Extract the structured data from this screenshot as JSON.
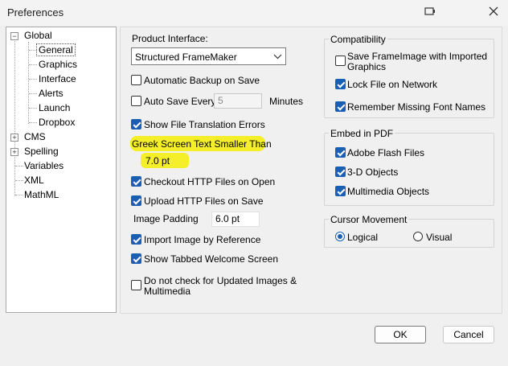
{
  "window": {
    "title": "Preferences"
  },
  "tree": {
    "items": [
      "Global",
      "General",
      "Graphics",
      "Interface",
      "Alerts",
      "Launch",
      "Dropbox",
      "CMS",
      "Spelling",
      "Variables",
      "XML",
      "MathML"
    ]
  },
  "general": {
    "product_interface_label": "Product Interface:",
    "product_interface_value": "Structured FrameMaker",
    "auto_backup_label": "Automatic Backup on Save",
    "auto_save_label": "Auto Save Every",
    "auto_save_value": "5",
    "auto_save_unit": "Minutes",
    "show_translation_errors_label": "Show File Translation Errors",
    "greek_label": "Greek Screen Text Smaller Than",
    "greek_value": "7.0 pt",
    "checkout_http_label": "Checkout HTTP Files on Open",
    "upload_http_label": "Upload HTTP Files on Save",
    "image_padding_label": "Image Padding",
    "image_padding_value": "6.0 pt",
    "import_by_reference_label": "Import Image by Reference",
    "tabbed_welcome_label": "Show Tabbed Welcome Screen",
    "no_check_updated_label_1": "Do not check for Updated Images &",
    "no_check_updated_label_2": "Multimedia"
  },
  "compatibility": {
    "title": "Compatibility",
    "save_frameimage_1": "Save FrameImage with Imported",
    "save_frameimage_2": "Graphics",
    "lock_file_label": "Lock File on Network",
    "remember_fonts_label": "Remember Missing Font Names"
  },
  "embed_pdf": {
    "title": "Embed in PDF",
    "flash_label": "Adobe Flash Files",
    "objects3d_label": "3-D Objects",
    "multimedia_label": "Multimedia Objects"
  },
  "cursor": {
    "title": "Cursor Movement",
    "logical_label": "Logical",
    "visual_label": "Visual"
  },
  "buttons": {
    "ok": "OK",
    "cancel": "Cancel"
  },
  "colors": {
    "highlight": "#f5ef2a",
    "accent": "#1a5fb4"
  },
  "icons": {
    "close": "close-icon",
    "help": "help-icon",
    "chevron": "chevron-down-icon"
  }
}
